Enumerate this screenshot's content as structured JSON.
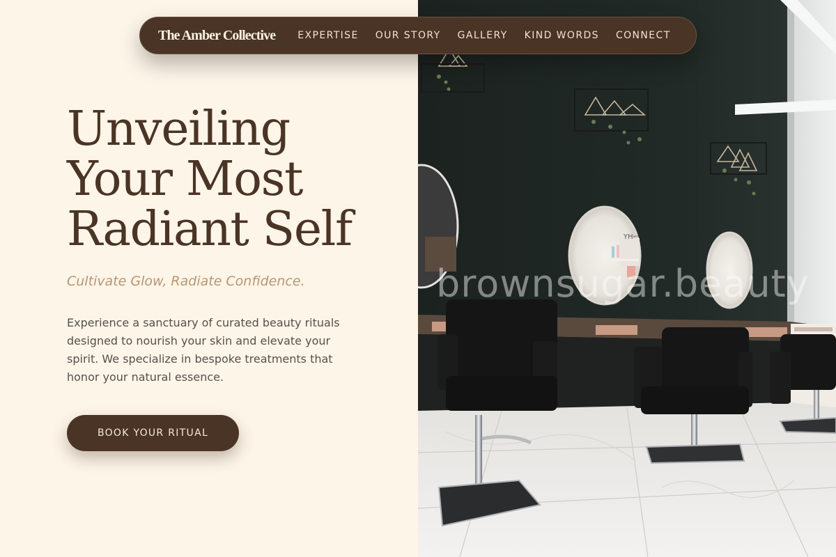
{
  "brand": {
    "name": "The Amber Collective"
  },
  "nav": {
    "links": [
      {
        "label": "EXPERTISE"
      },
      {
        "label": "OUR STORY"
      },
      {
        "label": "GALLERY"
      },
      {
        "label": "KIND WORDS"
      },
      {
        "label": "CONNECT"
      }
    ]
  },
  "hero": {
    "headline_lines": [
      "Unveiling",
      "Your Most",
      "Radiant Self"
    ],
    "tagline": "Cultivate Glow, Radiate Confidence.",
    "description": "Experience a sanctuary of curated beauty rituals designed to nourish your skin and elevate your spirit. We specialize in bespoke treatments that honor your natural essence.",
    "cta_label": "BOOK YOUR RITUAL"
  },
  "photo": {
    "watermark": "brownsugar.beauty",
    "sign_text": "YH⌐"
  },
  "colors": {
    "background": "#fdf5e8",
    "brand_brown": "#4a3425",
    "accent_gold": "#b99571",
    "body_text": "#56504b"
  }
}
